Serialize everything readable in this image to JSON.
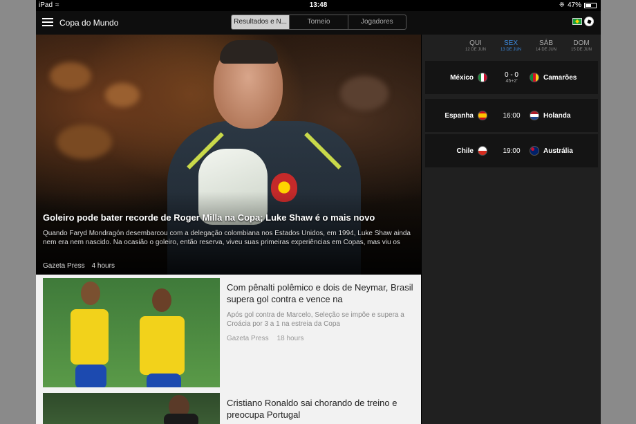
{
  "status_bar": {
    "device": "iPad",
    "time": "13:48",
    "battery": "47%",
    "battery_level": 0.47
  },
  "header": {
    "title": "Copa do Mundo",
    "tabs": [
      {
        "label": "Resultados e N..."
      },
      {
        "label": "Torneio"
      },
      {
        "label": "Jogadores"
      }
    ],
    "selected_tab": "Resultados e N..."
  },
  "hero": {
    "title": "Goleiro pode bater recorde de Roger Milla na Copa; Luke Shaw é o mais novo",
    "description": "Quando Faryd Mondragón desembarcou com a delegação colombiana nos Estados Unidos, em 1994, Luke Shaw ainda nem era nem nascido. Na ocasião o goleiro, então reserva, viveu suas primeiras experiências em Copas, mas viu os",
    "source": "Gazeta Press",
    "time": "4 hours"
  },
  "articles": [
    {
      "title": "Com pênalti polêmico e dois de Neymar, Brasil supera gol contra e vence na",
      "description": "Após gol contra de Marcelo, Seleção se impõe e supera a Croácia por 3 a 1 na estreia da Copa",
      "source": "Gazeta Press",
      "time": "18 hours"
    },
    {
      "title": "Cristiano Ronaldo sai chorando de treino e preocupa Portugal"
    }
  ],
  "schedule": {
    "days": [
      {
        "name": "QUI",
        "date": "12 DE JUN"
      },
      {
        "name": "SEX",
        "date": "13 DE JUN",
        "active": true
      },
      {
        "name": "SÁB",
        "date": "14 DE JUN"
      },
      {
        "name": "DOM",
        "date": "15 DE JUN"
      }
    ],
    "matches": [
      {
        "home": "México",
        "home_flag": "mexico-flag-icon",
        "center": "0 - 0",
        "sub": "45+2'",
        "away": "Camarões",
        "away_flag": "cameroon-flag-icon"
      },
      {
        "home": "Espanha",
        "home_flag": "spain-flag-icon",
        "center": "16:00",
        "sub": "",
        "away": "Holanda",
        "away_flag": "netherlands-flag-icon"
      },
      {
        "home": "Chile",
        "home_flag": "chile-flag-icon",
        "center": "19:00",
        "sub": "",
        "away": "Austrália",
        "away_flag": "australia-flag-icon"
      }
    ]
  },
  "colors": {
    "accent": "#3c8be0",
    "background": "#151515",
    "article_bg": "#f2f2f2"
  }
}
